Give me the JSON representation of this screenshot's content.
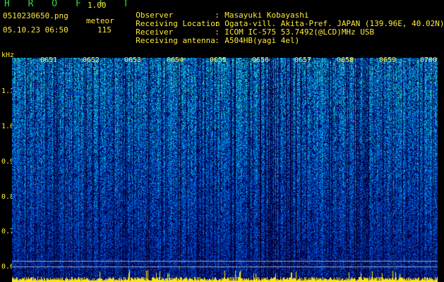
{
  "header": {
    "title": "H R O F F T",
    "version": "1.00",
    "file": "0510230650.png",
    "mode": "meteor",
    "datetime": "05.10.23 06:50",
    "count": "115"
  },
  "info": [
    {
      "key": "Observer",
      "value": "Masayuki Kobayashi"
    },
    {
      "key": "Receiving Location",
      "value": "Ogata-vill. Akita-Pref. JAPAN (139.96E, 40.02N)"
    },
    {
      "key": "Receiver",
      "value": "ICOM IC-575 53.7492(@LCD)MHz USB"
    },
    {
      "key": "Receiving antenna",
      "value": "A504HB(yagi 4el)"
    }
  ],
  "axis": {
    "unit": "kHz",
    "y_ticks": [
      "1.1",
      "1.0",
      "0.9",
      "0.8",
      "0.7",
      "0.6"
    ],
    "time_labels": [
      "0651",
      "0652",
      "0653",
      "0654",
      "0655",
      "0656",
      "0657",
      "0658",
      "0659",
      "0700"
    ]
  },
  "colors": {
    "header_text": "#ffea3a",
    "title_text": "#39d84a",
    "background": "#000000"
  }
}
